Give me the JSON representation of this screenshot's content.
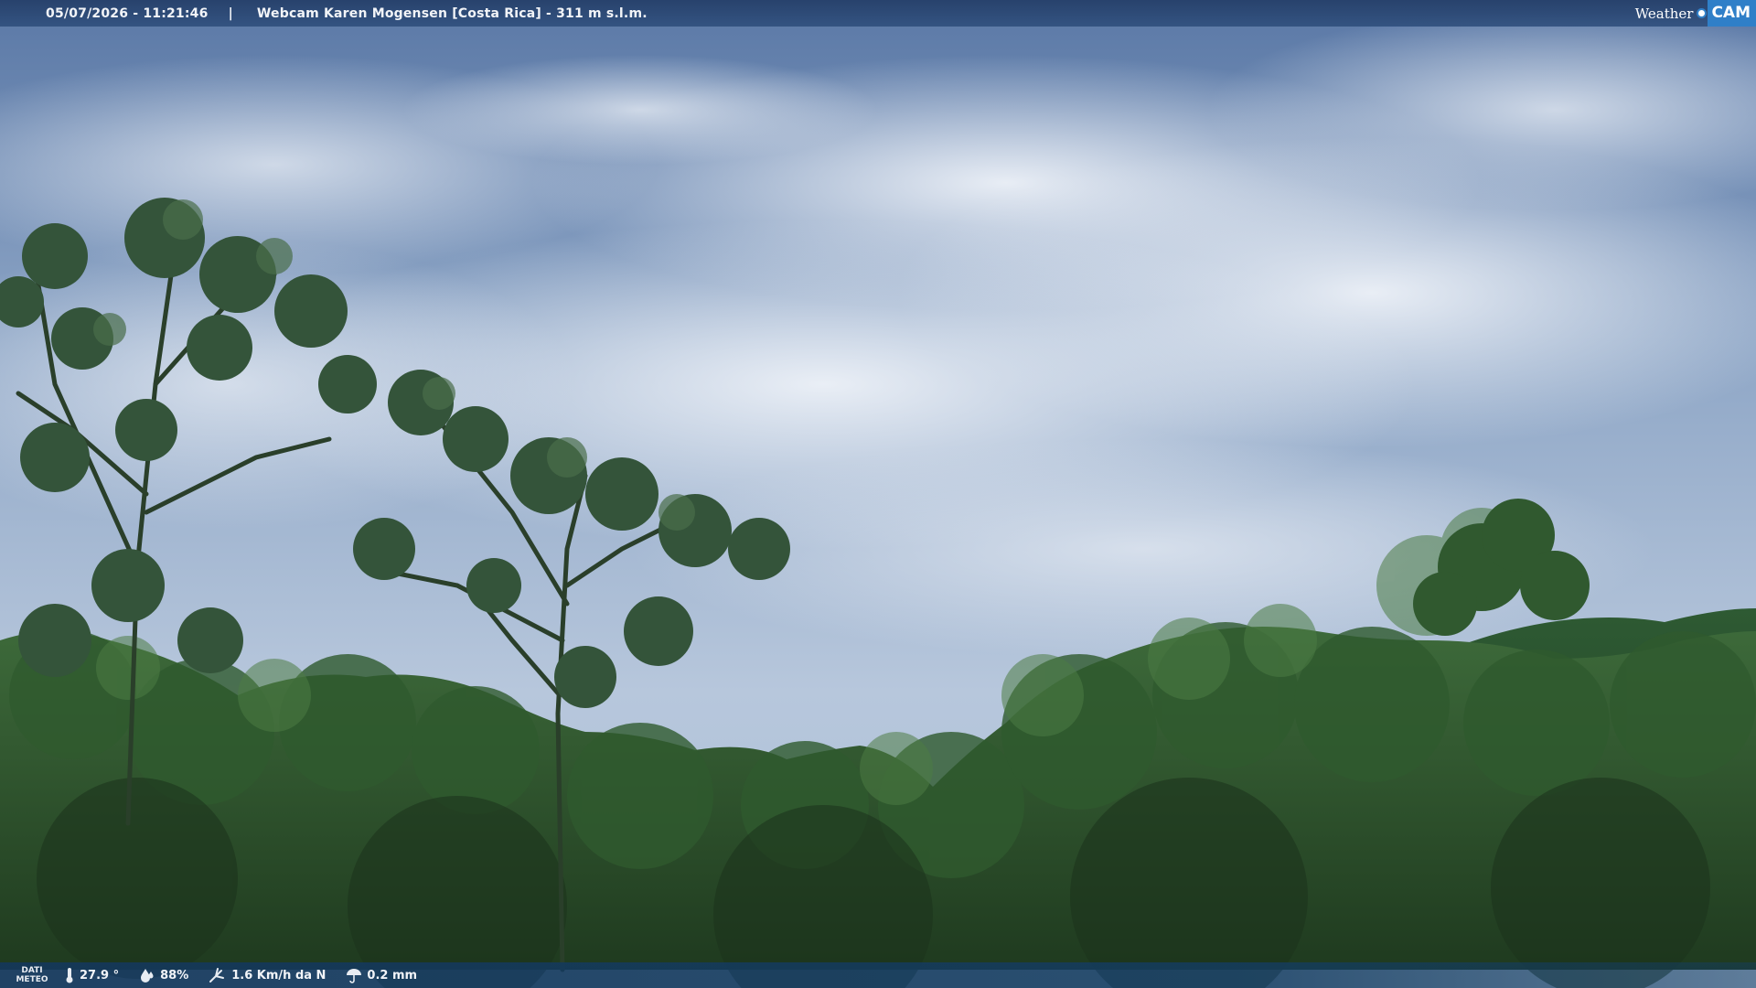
{
  "header": {
    "timestamp": "05/07/2026 - 11:21:46",
    "separator": "|",
    "camera_title": "Webcam Karen Mogensen [Costa Rica]  - 311 m s.l.m."
  },
  "brand": {
    "word": "Weather",
    "mark": "CAM",
    "accent_color": "#2f7fc8"
  },
  "footer": {
    "label_line1": "DATI",
    "label_line2": "METEO",
    "temperature": "27.9 °",
    "humidity": "88%",
    "wind": "1.6 Km/h da N",
    "rain": "0.2 mm"
  },
  "icons": {
    "temperature": "thermometer-icon",
    "humidity": "droplet-icon",
    "wind": "wind-icon",
    "rain": "umbrella-icon"
  }
}
